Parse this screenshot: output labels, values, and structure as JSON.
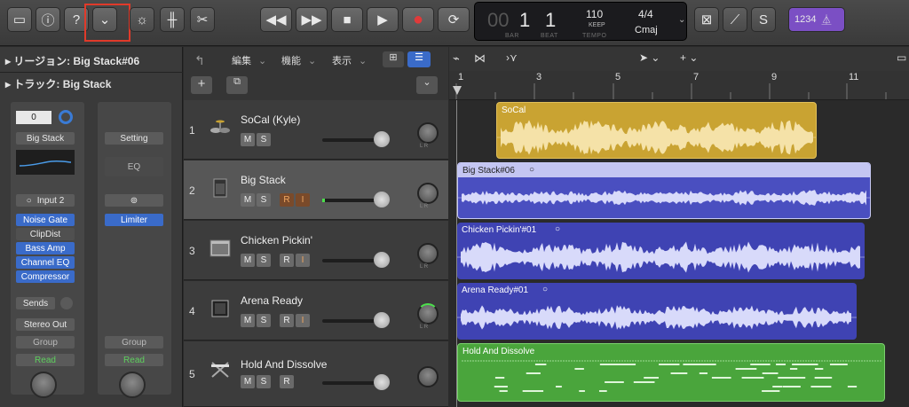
{
  "toolbar": {
    "lcd": {
      "bar": "1",
      "bar_label": "BAR",
      "beat": "1",
      "beat_label": "BEAT",
      "tempo": "110",
      "tempo_mode": "KEEP",
      "tempo_label": "TEMPO",
      "signature": "4/4",
      "key": "Cmaj",
      "prefix": "00"
    },
    "count_in": "1234"
  },
  "inspector": {
    "region_label": "リージョン: Big Stack#06",
    "track_label": "トラック: Big Stack",
    "strip1": {
      "volume": "0",
      "preset": "Big Stack",
      "input": "Input 2",
      "plugins": [
        "Noise Gate",
        "ClipDist",
        "Bass Amp",
        "Channel EQ",
        "Compressor"
      ],
      "sends": "Sends",
      "output": "Stereo Out",
      "group": "Group",
      "automation": "Read"
    },
    "strip2": {
      "preset": "Setting",
      "eq": "EQ",
      "plugins": [
        "Limiter"
      ],
      "group": "Group",
      "automation": "Read"
    }
  },
  "tracks_menu": {
    "edit": "編集",
    "functions": "機能",
    "view": "表示"
  },
  "ruler": [
    "1",
    "3",
    "5",
    "7",
    "9",
    "11"
  ],
  "tracks": [
    {
      "num": "1",
      "name": "SoCal (Kyle)",
      "buttons": [
        "M",
        "S"
      ]
    },
    {
      "num": "2",
      "name": "Big Stack",
      "buttons": [
        "M",
        "S",
        "R",
        "I"
      ]
    },
    {
      "num": "3",
      "name": "Chicken Pickin'",
      "buttons": [
        "M",
        "S",
        "R",
        "I"
      ]
    },
    {
      "num": "4",
      "name": "Arena Ready",
      "buttons": [
        "M",
        "S",
        "R",
        "I"
      ]
    },
    {
      "num": "5",
      "name": "Hold And Dissolve",
      "buttons": [
        "M",
        "S",
        "R"
      ]
    }
  ],
  "regions": [
    {
      "name": "SoCal",
      "color": "#c9a332"
    },
    {
      "name": "Big Stack#06",
      "color": "#4a4fc0"
    },
    {
      "name": "Chicken Pickin'#01",
      "color": "#3f43b3"
    },
    {
      "name": "Arena Ready#01",
      "color": "#3f43b3"
    },
    {
      "name": "Hold And Dissolve",
      "color": "#4aa53c"
    }
  ],
  "pan_labels": "L R"
}
